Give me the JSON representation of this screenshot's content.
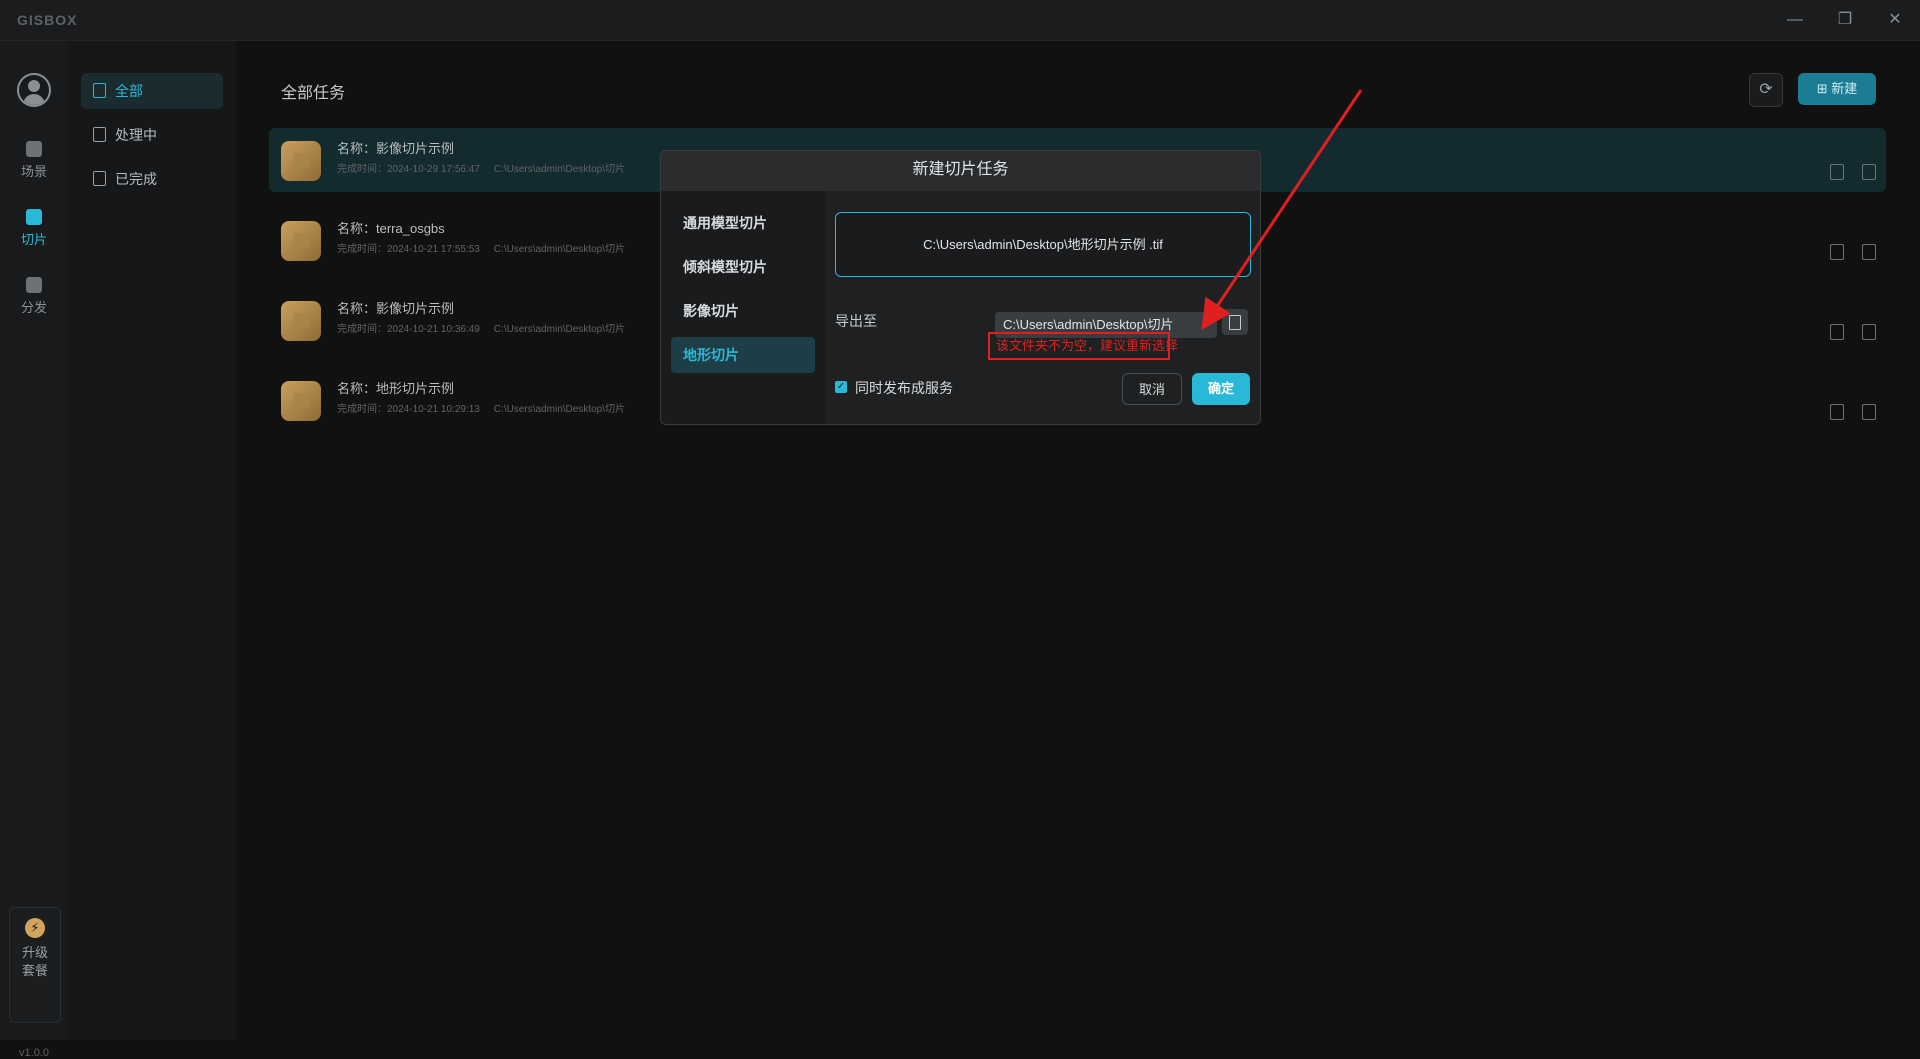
{
  "app": {
    "logo": "GISBOX",
    "version": "v1.0.0"
  },
  "window_controls": {
    "minimize": "—",
    "restore": "❐",
    "close": "✕"
  },
  "rail": {
    "items": [
      {
        "label": "场景",
        "icon": "home-icon"
      },
      {
        "label": "切片",
        "icon": "slice-icon"
      },
      {
        "label": "分发",
        "icon": "distribute-icon"
      }
    ],
    "active_index": 1,
    "upgrade": {
      "line1": "升级",
      "line2": "套餐",
      "icon": "⚡"
    }
  },
  "subnav": {
    "items": [
      {
        "label": "全部"
      },
      {
        "label": "处理中"
      },
      {
        "label": "已完成"
      }
    ],
    "active_index": 0
  },
  "main": {
    "title": "全部任务",
    "refresh_icon": "⟳",
    "new_button": "⊞ 新建",
    "tasks": [
      {
        "name": "名称：影像切片示例",
        "time": "完成时间：2024-10-29 17:56:47",
        "path": "C:\\Users\\admin\\Desktop\\切片"
      },
      {
        "name": "名称：terra_osgbs",
        "time": "完成时间：2024-10-21 17:55:53",
        "path": "C:\\Users\\admin\\Desktop\\切片"
      },
      {
        "name": "名称：影像切片示例",
        "time": "完成时间：2024-10-21 10:36:49",
        "path": "C:\\Users\\admin\\Desktop\\切片"
      },
      {
        "name": "名称：地形切片示例",
        "time": "完成时间：2024-10-21 10:29:13",
        "path": "C:\\Users\\admin\\Desktop\\切片"
      }
    ]
  },
  "dialog": {
    "title": "新建切片任务",
    "types": [
      {
        "label": "通用模型切片"
      },
      {
        "label": "倾斜模型切片"
      },
      {
        "label": "影像切片"
      },
      {
        "label": "地形切片"
      }
    ],
    "active_type_index": 3,
    "file": "C:\\Users\\admin\\Desktop\\地形切片示例 .tif",
    "export_label": "导出至",
    "export_value": "C:\\Users\\admin\\Desktop\\切片",
    "error": "该文件夹不为空，建议重新选择",
    "checkbox_label": "同时发布成服务",
    "checkbox_checked": true,
    "cancel": "取消",
    "ok": "确定"
  },
  "colors": {
    "accent": "#2ab8d8",
    "error": "#e02020",
    "background": "#111111"
  }
}
